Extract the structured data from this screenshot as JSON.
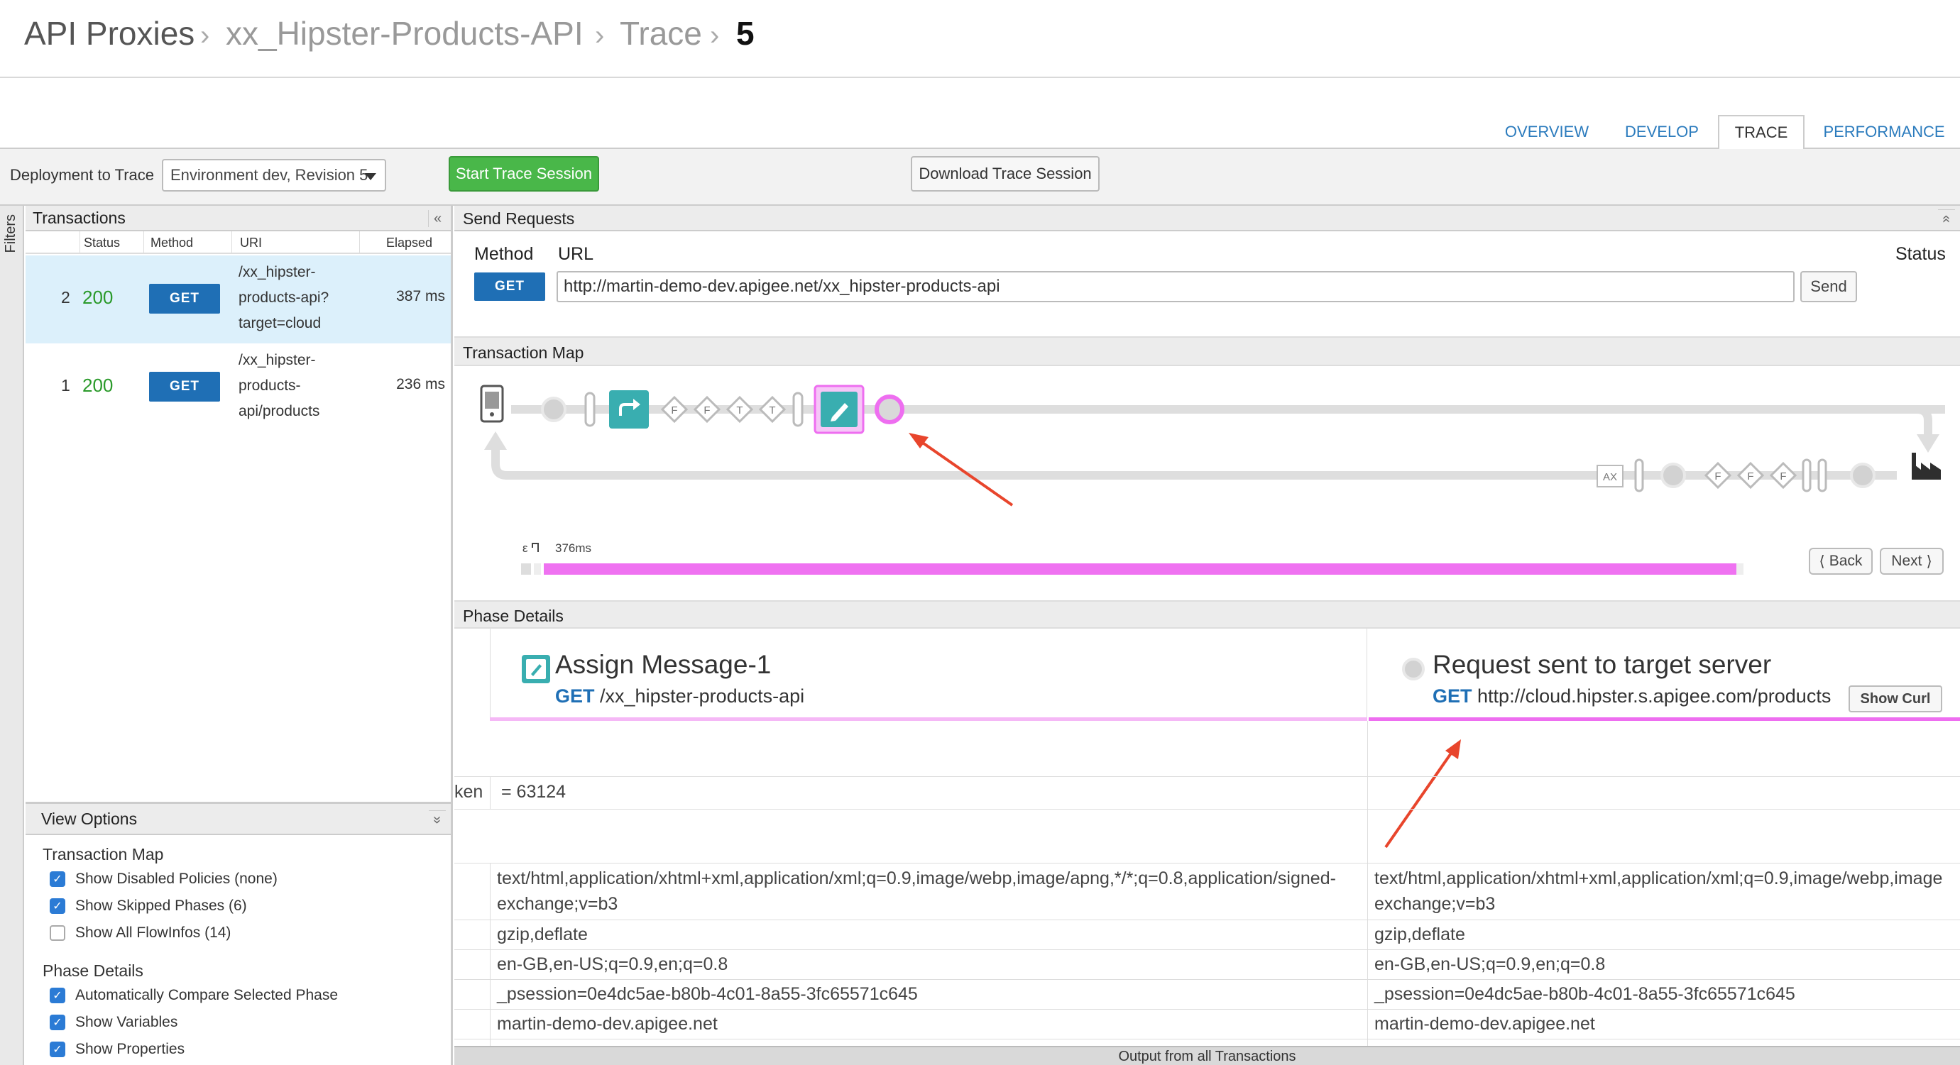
{
  "breadcrumb": {
    "items": [
      "API Proxies",
      "xx_Hipster-Products-API",
      "Trace",
      "5"
    ],
    "separator": "›"
  },
  "tabs": [
    {
      "label": "OVERVIEW",
      "active": false
    },
    {
      "label": "DEVELOP",
      "active": false
    },
    {
      "label": "TRACE",
      "active": true
    },
    {
      "label": "PERFORMANCE",
      "active": false
    }
  ],
  "toolbar": {
    "deployment_label": "Deployment to Trace",
    "deployment_value": "Environment dev, Revision 5",
    "start_label": "Start Trace Session",
    "download_label": "Download Trace Session"
  },
  "filters_label": "Filters",
  "transactions": {
    "title": "Transactions",
    "collapse": "«",
    "columns": {
      "status": "Status",
      "method": "Method",
      "uri": "URI",
      "elapsed": "Elapsed"
    },
    "rows": [
      {
        "num": "2",
        "status": "200",
        "method": "GET",
        "uri": [
          "/xx_hipster-",
          "products-api?",
          "target=cloud"
        ],
        "elapsed": "387 ms",
        "selected": true
      },
      {
        "num": "1",
        "status": "200",
        "method": "GET",
        "uri": [
          "/xx_hipster-",
          "products-",
          "api/products"
        ],
        "elapsed": "236 ms",
        "selected": false
      }
    ]
  },
  "view_options": {
    "title": "View Options",
    "collapse": "»",
    "sections": [
      {
        "title": "Transaction Map",
        "items": [
          {
            "label": "Show Disabled Policies (none)",
            "checked": true
          },
          {
            "label": "Show Skipped Phases (6)",
            "checked": true
          },
          {
            "label": "Show All FlowInfos (14)",
            "checked": false
          }
        ]
      },
      {
        "title": "Phase Details",
        "items": [
          {
            "label": "Automatically Compare Selected Phase",
            "checked": true
          },
          {
            "label": "Show Variables",
            "checked": true
          },
          {
            "label": "Show Properties",
            "checked": true
          }
        ]
      }
    ]
  },
  "send_requests": {
    "title": "Send Requests",
    "method_label": "Method",
    "url_label": "URL",
    "status_label": "Status",
    "method_value": "GET",
    "url_value": "http://martin-demo-dev.apigee.net/xx_hipster-products-api",
    "send_label": "Send",
    "collapse": "«"
  },
  "transaction_map": {
    "title": "Transaction Map",
    "flow_labels": [
      "F",
      "F",
      "T",
      "T"
    ],
    "return_labels": [
      "AX",
      "F",
      "F",
      "F"
    ],
    "timeline_start": "ε",
    "timeline_label": "376ms",
    "back_label": "Back",
    "next_label": "Next",
    "back_glyph": "⟨",
    "next_glyph": "⟩"
  },
  "phase_details": {
    "title": "Phase Details",
    "left": {
      "title": "Assign Message-1",
      "method": "GET",
      "path": "/xx_hipster-products-api"
    },
    "right": {
      "title": "Request sent to target server",
      "method": "GET",
      "path": "http://cloud.hipster.s.apigee.com/products"
    },
    "show_curl_label": "Show Curl"
  },
  "detail_rows": {
    "token_key": "ken",
    "token_value": "= 63124",
    "accept_line1_left": "text/html,application/xhtml+xml,application/xml;q=0.9,image/webp,image/apng,*/*;q=0.8,application/signed-",
    "accept_line1_right": "text/html,application/xhtml+xml,application/xml;q=0.9,image/webp,image",
    "accept_line2": "exchange;v=b3",
    "encoding": "gzip,deflate",
    "language": "en-GB,en-US;q=0.9,en;q=0.8",
    "cookie": "_psession=0e4dc5ae-b80b-4c01-8a55-3fc65571c645",
    "host": "martin-demo-dev.apigee.net"
  },
  "footer": "Output from all Transactions",
  "colors": {
    "accent_blue": "#1f6fb5",
    "success_green": "#2a9a2a",
    "start_green": "#49b749",
    "highlight_pink": "#ee6ef0",
    "teal": "#39aeb0",
    "arrow_red": "#e8452c"
  }
}
